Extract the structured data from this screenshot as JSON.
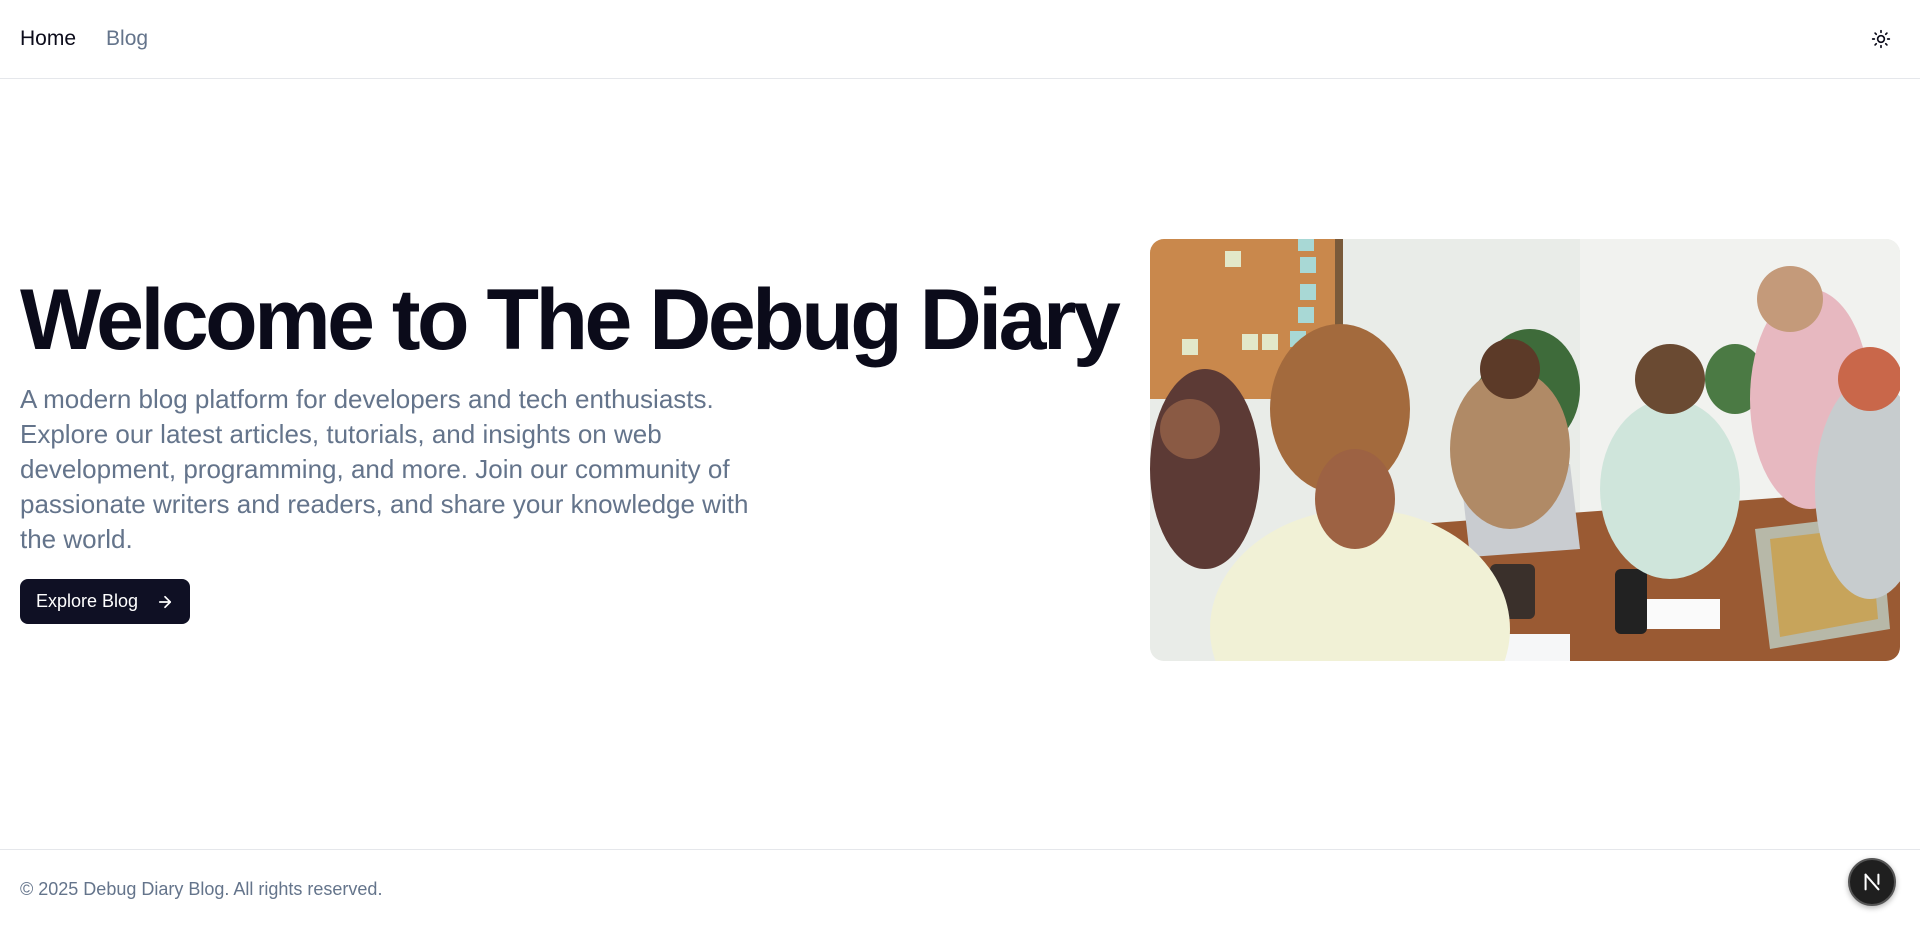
{
  "nav": {
    "items": [
      {
        "label": "Home"
      },
      {
        "label": "Blog"
      }
    ],
    "theme_icon": "sun-icon"
  },
  "hero": {
    "title": "Welcome to The Debug Diary",
    "description": "A modern blog platform for developers and tech enthusiasts. Explore our latest articles, tutorials, and insights on web development, programming, and more. Join our community of passionate writers and readers, and share your knowledge with the world.",
    "cta_label": "Explore Blog",
    "cta_icon": "arrow-right-icon",
    "image_name": "team-meeting-photo"
  },
  "footer": {
    "text": "© 2025 Debug Diary Blog. All rights reserved."
  },
  "colors": {
    "primary": "#0f1024",
    "muted_text": "#64748b",
    "border": "#e5e7eb"
  }
}
